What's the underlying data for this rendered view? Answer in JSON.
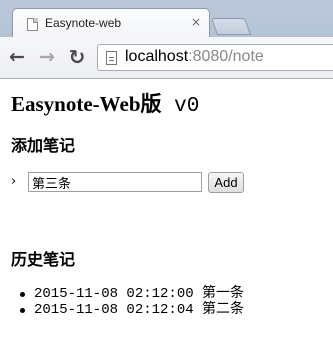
{
  "browser": {
    "tab_title": "Easynote-web",
    "tab_close": "×",
    "url_host": "localhost",
    "url_rest": ":8080/note",
    "icons": [
      "back-arrow-icon",
      "forward-arrow-icon",
      "reload-icon",
      "page-icon"
    ]
  },
  "page": {
    "title": "Easynote-Web版",
    "title_version": " v0",
    "add_heading": "添加笔记",
    "prompt": "›",
    "input_value": "第三条",
    "add_button": "Add",
    "history_heading": "历史笔记",
    "history": [
      "2015-11-08 02:12:00 第一条",
      "2015-11-08 02:12:04 第二条"
    ]
  }
}
